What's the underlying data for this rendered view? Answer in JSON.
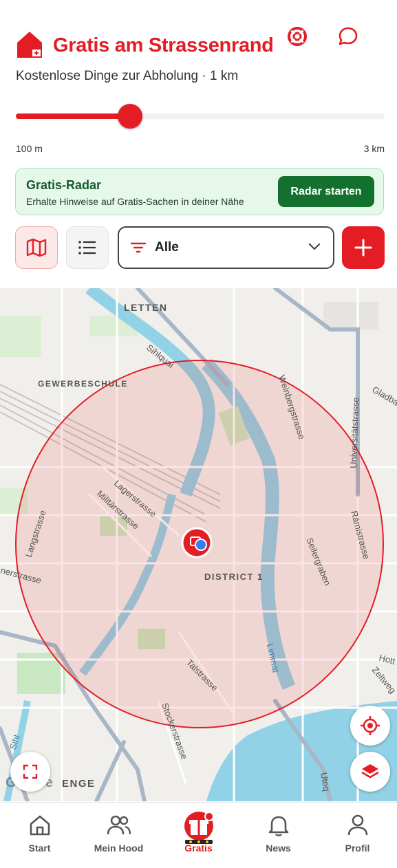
{
  "header": {
    "title": "Gratis am Strassenrand",
    "subtitle": "Kostenlose Dinge zur Abholung · 1 km"
  },
  "distance": {
    "min_label": "100 m",
    "max_label": "3 km",
    "value_km": 1,
    "fraction": 0.31
  },
  "radar": {
    "title": "Gratis-Radar",
    "description": "Erhalte Hinweise auf Gratis-Sachen in deiner Nähe",
    "button": "Radar starten"
  },
  "filter": {
    "selected": "Alle"
  },
  "map": {
    "labels": {
      "letten": "LETTEN",
      "gewerbeschule": "GEWERBESCHULE",
      "district1": "DISTRICT 1",
      "enge": "ENGE",
      "sihlquai": "Sihlquai",
      "weinbergstrasse": "Weinbergstrasse",
      "universitaetstrasse": "Universitätstrasse",
      "gladbach": "Gladba",
      "lagerstrasse": "Lagerstrasse",
      "militaerstrasse": "Militärstrasse",
      "langstrasse": "Langstrasse",
      "herstrasse": "nerstrasse",
      "raemistrasse": "Rämistrasse",
      "seilergraben": "Seilergraben",
      "limmat": "Limmat",
      "talstrasse": "Talstrasse",
      "stockerstrasse": "Stockerstrasse",
      "zeltweg": "Zeltweg",
      "hott": "Hott",
      "sihl": "Sihl",
      "utoq": "Utoq"
    },
    "attribution": "Google",
    "radius_color": "#e41d25"
  },
  "nav": {
    "items": [
      {
        "label": "Start",
        "icon": "home-icon"
      },
      {
        "label": "Mein Hood",
        "icon": "people-icon"
      },
      {
        "label": "Gratis",
        "icon": "gift-icon"
      },
      {
        "label": "News",
        "icon": "bell-icon"
      },
      {
        "label": "Profil",
        "icon": "person-icon"
      }
    ],
    "active": "Gratis"
  },
  "colors": {
    "accent": "#e41d25",
    "radar_green": "#14702f"
  }
}
